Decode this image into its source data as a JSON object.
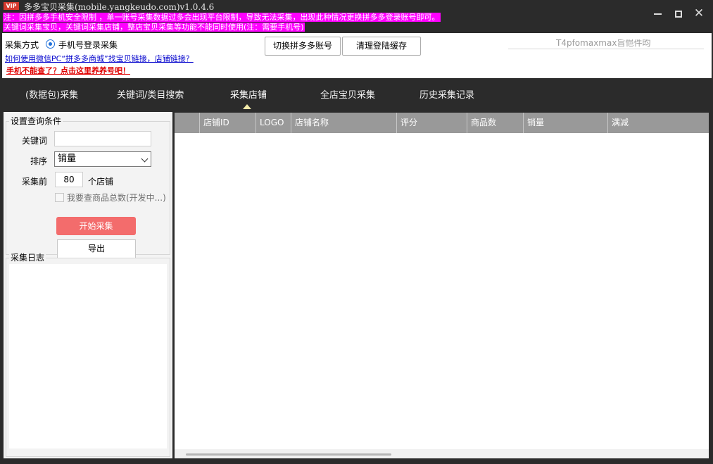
{
  "window": {
    "badge": "VIP",
    "title": "多多宝贝采集(mobile.yangkeudo.com)v1.0.4.6",
    "notice1": "注：因拼多多手机安全限制 ，单一账号采集数据过多会出现平台限制，导致无法采集，出现此种情况更换拼多多登录账号即可。",
    "notice2": "关键词采集宝贝，关键词采集店铺，整店宝贝采集等功能不能同时使用(注：需要手机号)",
    "minimize_icon": "minimize-icon",
    "maximize_icon": "maximize-icon",
    "close_glyph": "✕"
  },
  "options": {
    "mode_label": "采集方式",
    "mode_radio_label": "手机号登录采集",
    "help_link": "如何使用微信PC“拼多多商城”找宝贝链接，店铺链接？",
    "warn_link": "手机不能查了？点击这里养养号吧！",
    "switch_button": "切换拼多多账号",
    "clear_button": "清理登陆缓存",
    "ghost_text": "T4pfomaxmax旨悒件昀"
  },
  "nav": {
    "tabs": [
      {
        "label": "(数据包)采集"
      },
      {
        "label": "关键词/类目搜索"
      },
      {
        "label": "采集店铺"
      },
      {
        "label": "全店宝贝采集"
      },
      {
        "label": "历史采集记录"
      }
    ],
    "active_index": 2,
    "caret_color": "#f1e9a8"
  },
  "query": {
    "group_title": "设置查询条件",
    "keyword_label": "关键词",
    "keyword_value": "",
    "sort_label": "排序",
    "sort_value": "销量",
    "count_label": "采集前",
    "count_value": "80",
    "count_unit": "个店铺",
    "checkbox_label": "我要查商品总数(开发中...)",
    "checkbox_checked": false,
    "start_button": "开始采集",
    "start_button_color": "#f36c6c",
    "export_button": "导出"
  },
  "log": {
    "group_title": "采集日志"
  },
  "table": {
    "columns": [
      "店铺ID",
      "LOGO",
      "店铺名称",
      "评分",
      "商品数",
      "销量",
      "满减"
    ],
    "rows": [],
    "header_color": "#999999"
  }
}
